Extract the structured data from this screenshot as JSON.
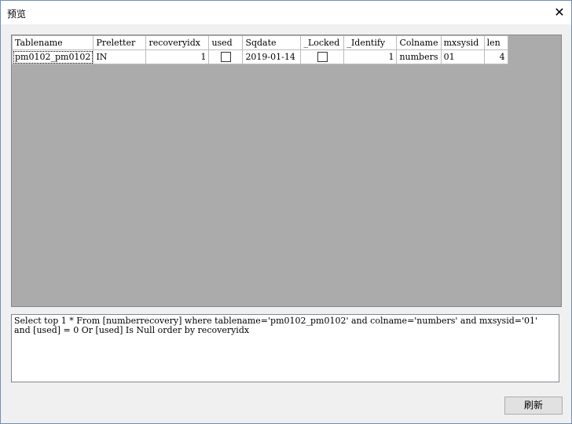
{
  "window": {
    "title": "预览",
    "close_glyph": "✕"
  },
  "grid": {
    "columns": [
      "Tablename",
      "Preletter",
      "recoveryidx",
      "used",
      "Sqdate",
      "_Locked",
      "_Identify",
      "Colname",
      "mxsysid",
      "len"
    ],
    "rows": [
      {
        "Tablename": "pm0102_pm0102",
        "Preletter": "IN",
        "recoveryidx": "1",
        "used": false,
        "Sqdate": "2019-01-14",
        "_Locked": false,
        "_Identify": "1",
        "Colname": "numbers",
        "mxsysid": "01",
        "len": "4"
      }
    ]
  },
  "sql": {
    "text": "Select top 1 * From [numberrecovery] where tablename='pm0102_pm0102' and colname='numbers' and mxsysid='01' and [used] = 0 Or [used] Is Null order by recoveryidx"
  },
  "buttons": {
    "refresh_label": "刷新"
  }
}
